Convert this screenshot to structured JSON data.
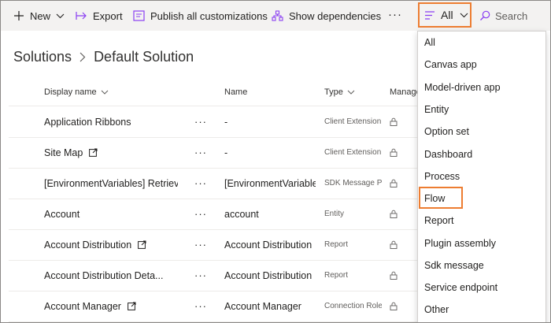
{
  "toolbar": {
    "new_label": "New",
    "export_label": "Export",
    "publish_label": "Publish all customizations",
    "dependencies_label": "Show dependencies",
    "more_label": "···",
    "filter_label": "All",
    "search_label": "Search"
  },
  "breadcrumb": {
    "root": "Solutions",
    "current": "Default Solution"
  },
  "table": {
    "headers": {
      "display_name": "Display name",
      "name": "Name",
      "type": "Type",
      "managed": "Manage"
    },
    "row_menu": "···",
    "rows": [
      {
        "display_name": "Application Ribbons",
        "name": "-",
        "type": "Client Extension",
        "external": false
      },
      {
        "display_name": "Site Map",
        "name": "-",
        "type": "Client Extension",
        "external": true
      },
      {
        "display_name": "[EnvironmentVariables] RetrieveM",
        "name": "[EnvironmentVariable",
        "type": "SDK Message P",
        "external": false
      },
      {
        "display_name": "Account",
        "name": "account",
        "type": "Entity",
        "external": false
      },
      {
        "display_name": "Account Distribution",
        "name": "Account Distribution",
        "type": "Report",
        "external": true
      },
      {
        "display_name": "Account Distribution Deta...",
        "name": "Account Distribution",
        "type": "Report",
        "external": false
      },
      {
        "display_name": "Account Manager",
        "name": "Account Manager",
        "type": "Connection Role",
        "external": true
      }
    ]
  },
  "filter_menu": {
    "items": [
      "All",
      "Canvas app",
      "Model-driven app",
      "Entity",
      "Option set",
      "Dashboard",
      "Process",
      "Flow",
      "Report",
      "Plugin assembly",
      "Sdk message",
      "Service endpoint",
      "Other"
    ],
    "highlighted": "Flow"
  },
  "colors": {
    "accent": "#8a3ff2",
    "highlight_border": "#ed7d31",
    "toolbar_bg": "#f3f2f1"
  }
}
